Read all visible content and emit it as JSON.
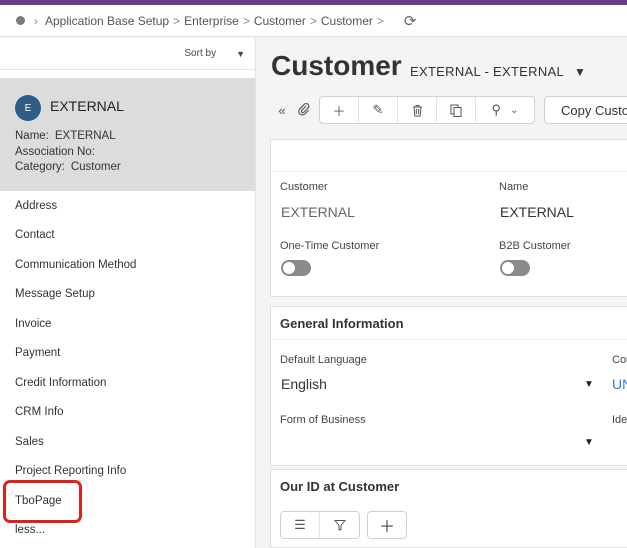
{
  "breadcrumb": {
    "items": [
      "Application Base Setup",
      "Enterprise",
      "Customer",
      "Customer"
    ],
    "separator": ">"
  },
  "sidebar": {
    "sort_label": "Sort by",
    "record": {
      "avatar_letter": "E",
      "title": "EXTERNAL",
      "fields": [
        {
          "label": "Name:",
          "value": "EXTERNAL"
        },
        {
          "label": "Association No:",
          "value": ""
        },
        {
          "label": "Category:",
          "value": "Customer"
        }
      ]
    },
    "nav_items": [
      "Address",
      "Contact",
      "Communication Method",
      "Message Setup",
      "Invoice",
      "Payment",
      "Credit Information",
      "CRM Info",
      "Sales",
      "Project Reporting Info",
      "TboPage",
      "less..."
    ],
    "highlighted_item": "TboPage"
  },
  "main": {
    "title": "Customer",
    "subtitle": "EXTERNAL - EXTERNAL",
    "toolbar": {
      "copy_label": "Copy Custo"
    },
    "header_card": {
      "customer_label": "Customer",
      "customer_value": "EXTERNAL",
      "name_label": "Name",
      "name_value": "EXTERNAL",
      "one_time_label": "One-Time Customer",
      "one_time_value": false,
      "b2b_label": "B2B Customer",
      "b2b_value": false
    },
    "general": {
      "title": "General Information",
      "default_language_label": "Default Language",
      "default_language_value": "English",
      "country_label": "Cou",
      "country_value": "UN",
      "form_of_business_label": "Form of Business",
      "form_of_business_value": "",
      "identifier_label": "Ide"
    },
    "our_id": {
      "title": "Our ID at Customer"
    }
  },
  "colors": {
    "accent_bar": "#6b3f87",
    "avatar": "#2f5d8a",
    "highlight": "#e0201d",
    "link": "#2b7bd4"
  }
}
